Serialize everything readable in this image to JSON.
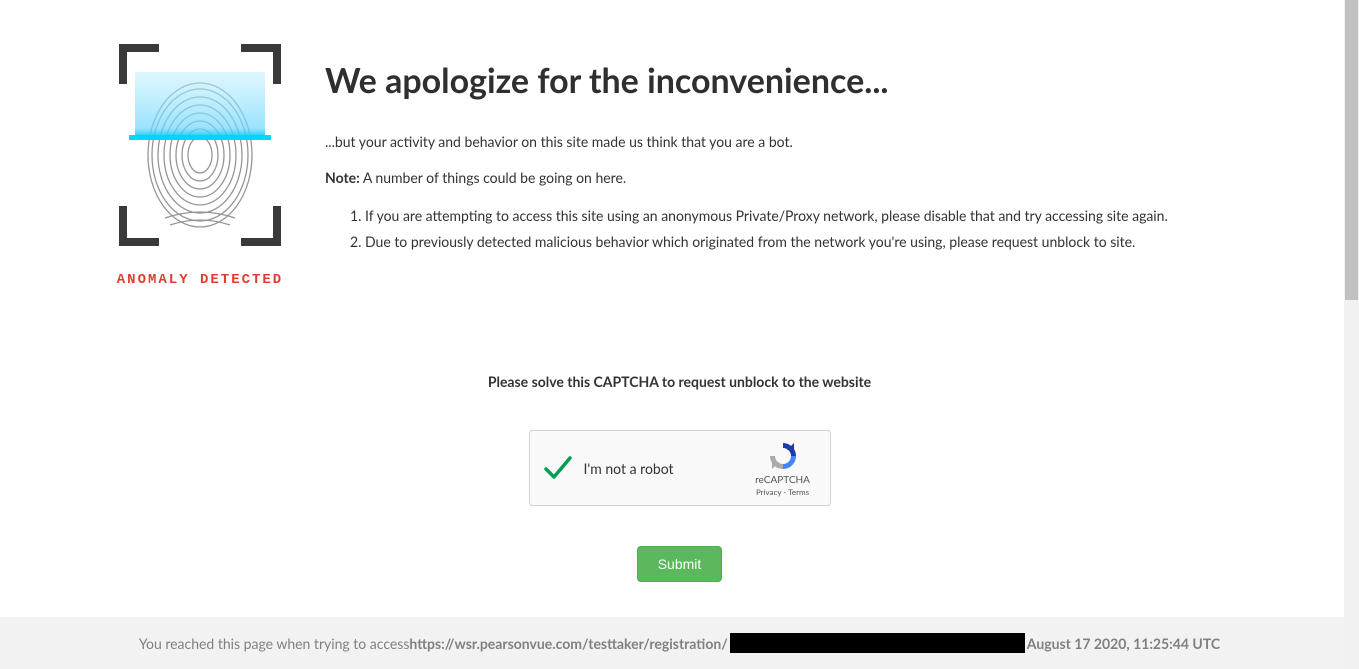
{
  "graphic": {
    "anomaly_label": "ANOMALY DETECTED"
  },
  "content": {
    "heading": "We apologize for the inconvenience...",
    "intro": "...but your activity and behavior on this site made us think that you are a bot.",
    "note_label": "Note:",
    "note_text": " A number of things could be going on here.",
    "reasons": [
      "If you are attempting to access this site using an anonymous Private/Proxy network, please disable that and try accessing site again.",
      "Due to previously detected malicious behavior which originated from the network you're using, please request unblock to site."
    ]
  },
  "captcha": {
    "heading": "Please solve this CAPTCHA to request unblock to the website",
    "checkbox_label": "I'm not a robot",
    "brand": "reCAPTCHA",
    "privacy": "Privacy",
    "terms": "Terms",
    "separator": " - ",
    "submit_label": "Submit"
  },
  "footer": {
    "prefix": "You reached this page when trying to access ",
    "url": "https://wsr.pearsonvue.com/testtaker/registration/",
    "date": "August 17 2020, 11:25:44 UTC"
  }
}
